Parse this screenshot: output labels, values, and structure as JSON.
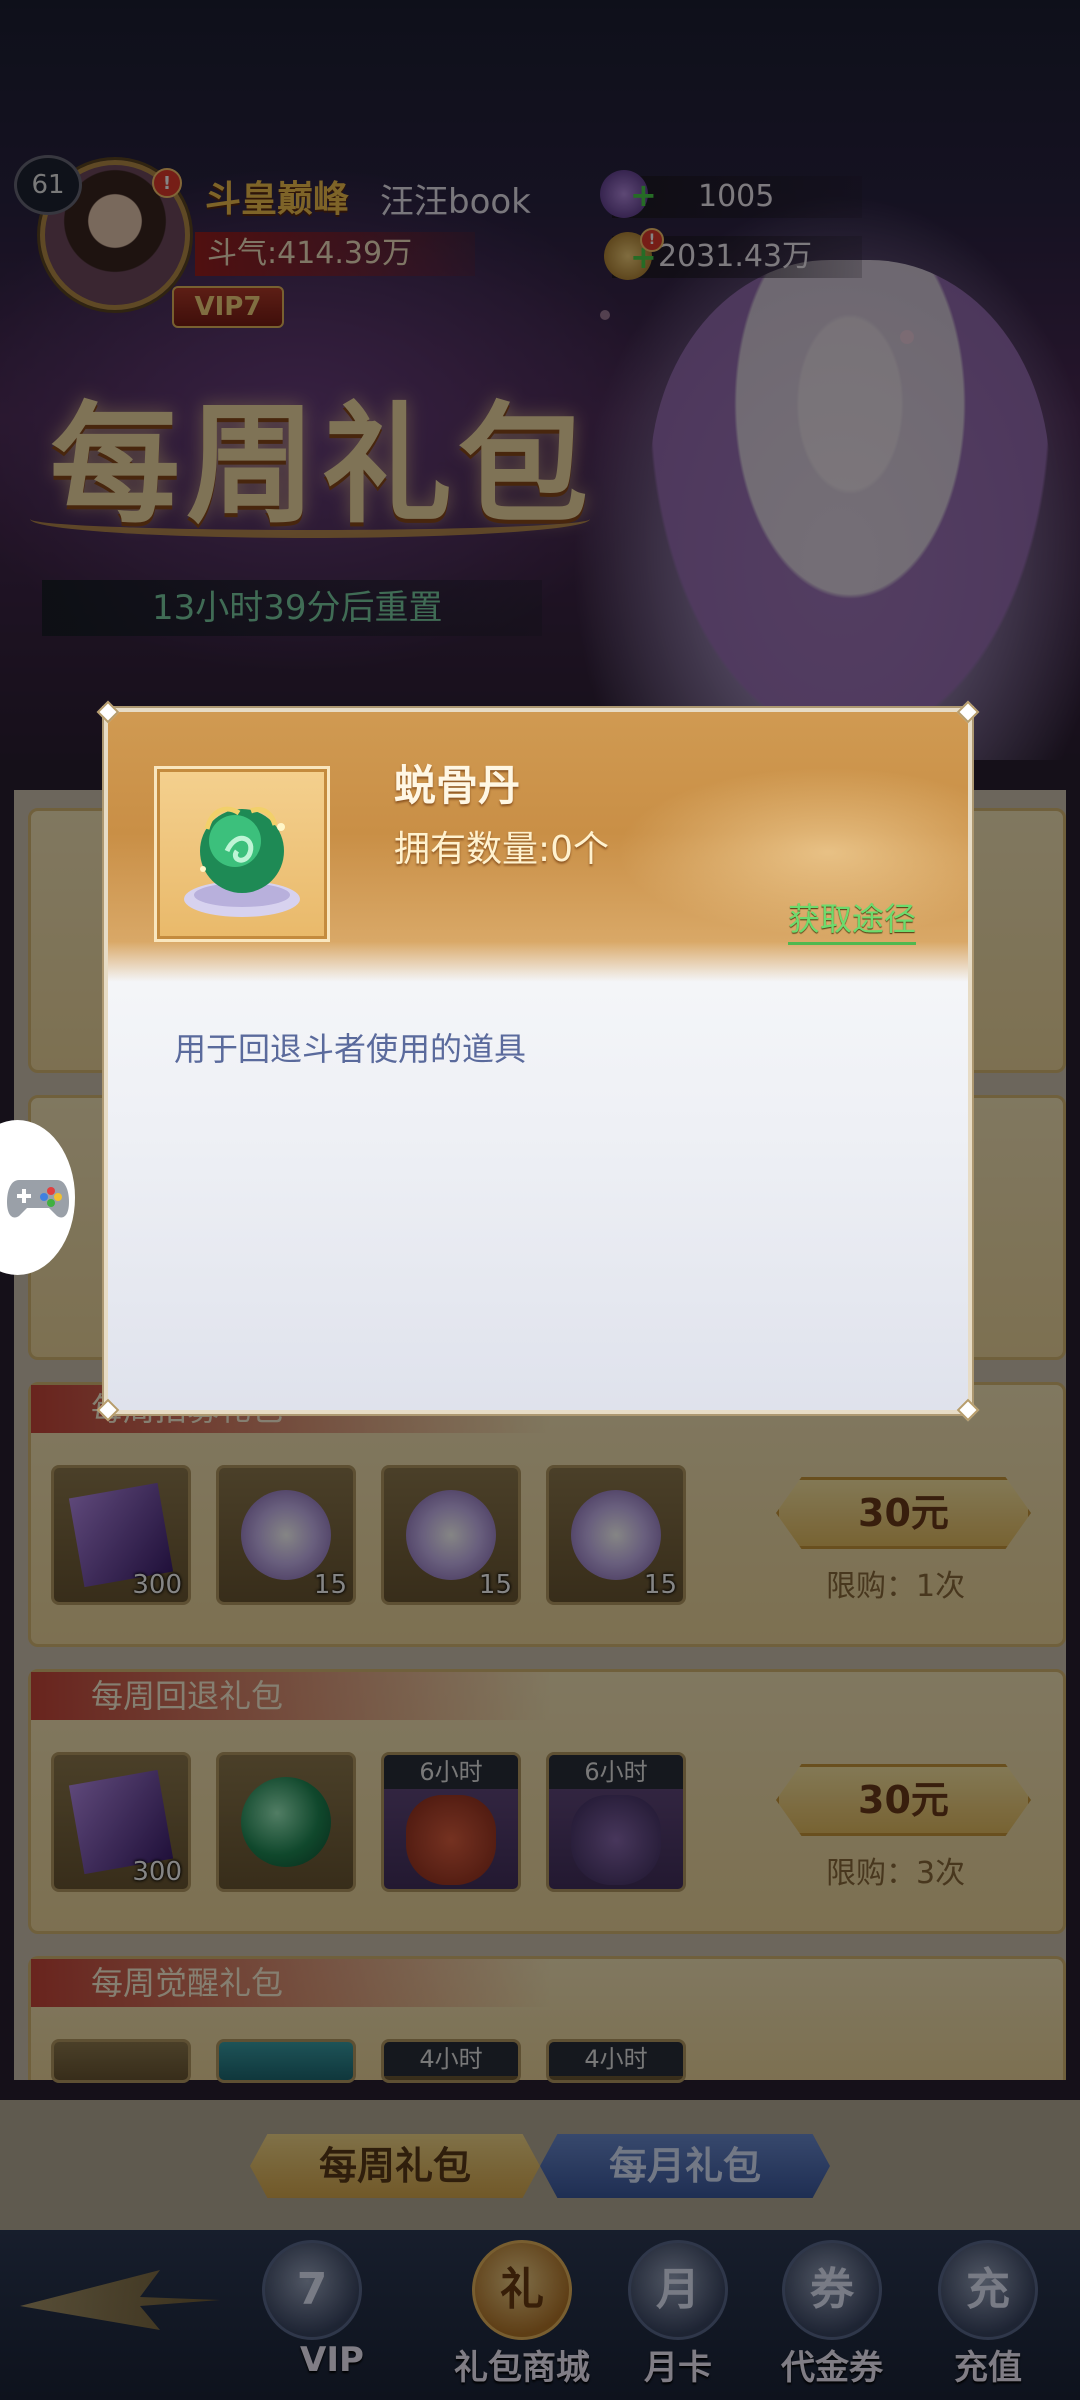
{
  "header": {
    "level": "61",
    "player_title": "斗皇巅峰",
    "player_name": "汪汪book",
    "power": "斗气:414.39万",
    "vip": "VIP7",
    "currency_1": "1005",
    "currency_2": "2031.43万",
    "alert_mark": "!"
  },
  "banner": {
    "title": "每周礼包",
    "reset_timer": "13小时39分后重置"
  },
  "packs": [
    {
      "title": "每周招募礼包",
      "price": "30元",
      "limit": "限购：1次",
      "items": [
        {
          "qty": "300",
          "time_tag": ""
        },
        {
          "qty": "15",
          "time_tag": ""
        },
        {
          "qty": "15",
          "time_tag": ""
        },
        {
          "qty": "15",
          "time_tag": ""
        }
      ]
    },
    {
      "title": "每周回退礼包",
      "price": "30元",
      "limit": "限购：3次",
      "items": [
        {
          "qty": "300",
          "time_tag": ""
        },
        {
          "qty": "",
          "time_tag": ""
        },
        {
          "qty": "",
          "time_tag": "6小时"
        },
        {
          "qty": "",
          "time_tag": "6小时"
        }
      ]
    },
    {
      "title": "每周觉醒礼包",
      "price": "",
      "limit": "",
      "items": [
        {
          "qty": "",
          "time_tag": ""
        },
        {
          "qty": "",
          "time_tag": ""
        },
        {
          "qty": "",
          "time_tag": "4小时"
        },
        {
          "qty": "",
          "time_tag": "4小时"
        }
      ]
    }
  ],
  "tabs": {
    "weekly": "每周礼包",
    "monthly": "每月礼包"
  },
  "nav": [
    {
      "label": "VIP",
      "icon": "vip-icon",
      "glyph": "7"
    },
    {
      "label": "礼包商城",
      "icon": "gift-shop-icon",
      "glyph": "礼"
    },
    {
      "label": "月卡",
      "icon": "month-card-icon",
      "glyph": "月"
    },
    {
      "label": "代金券",
      "icon": "voucher-icon",
      "glyph": "券"
    },
    {
      "label": "充值",
      "icon": "recharge-icon",
      "glyph": "充"
    }
  ],
  "modal": {
    "item_name": "蜕骨丹",
    "owned_count": "拥有数量:0个",
    "acquire_link": "获取途径",
    "description": "用于回退斗者使用的道具"
  },
  "colors": {
    "accent_gold": "#d09a52",
    "link_green": "#6ddb6d",
    "desc_blue": "#5a6a9c",
    "monthly_tab_blue": "#3c5aa0"
  }
}
